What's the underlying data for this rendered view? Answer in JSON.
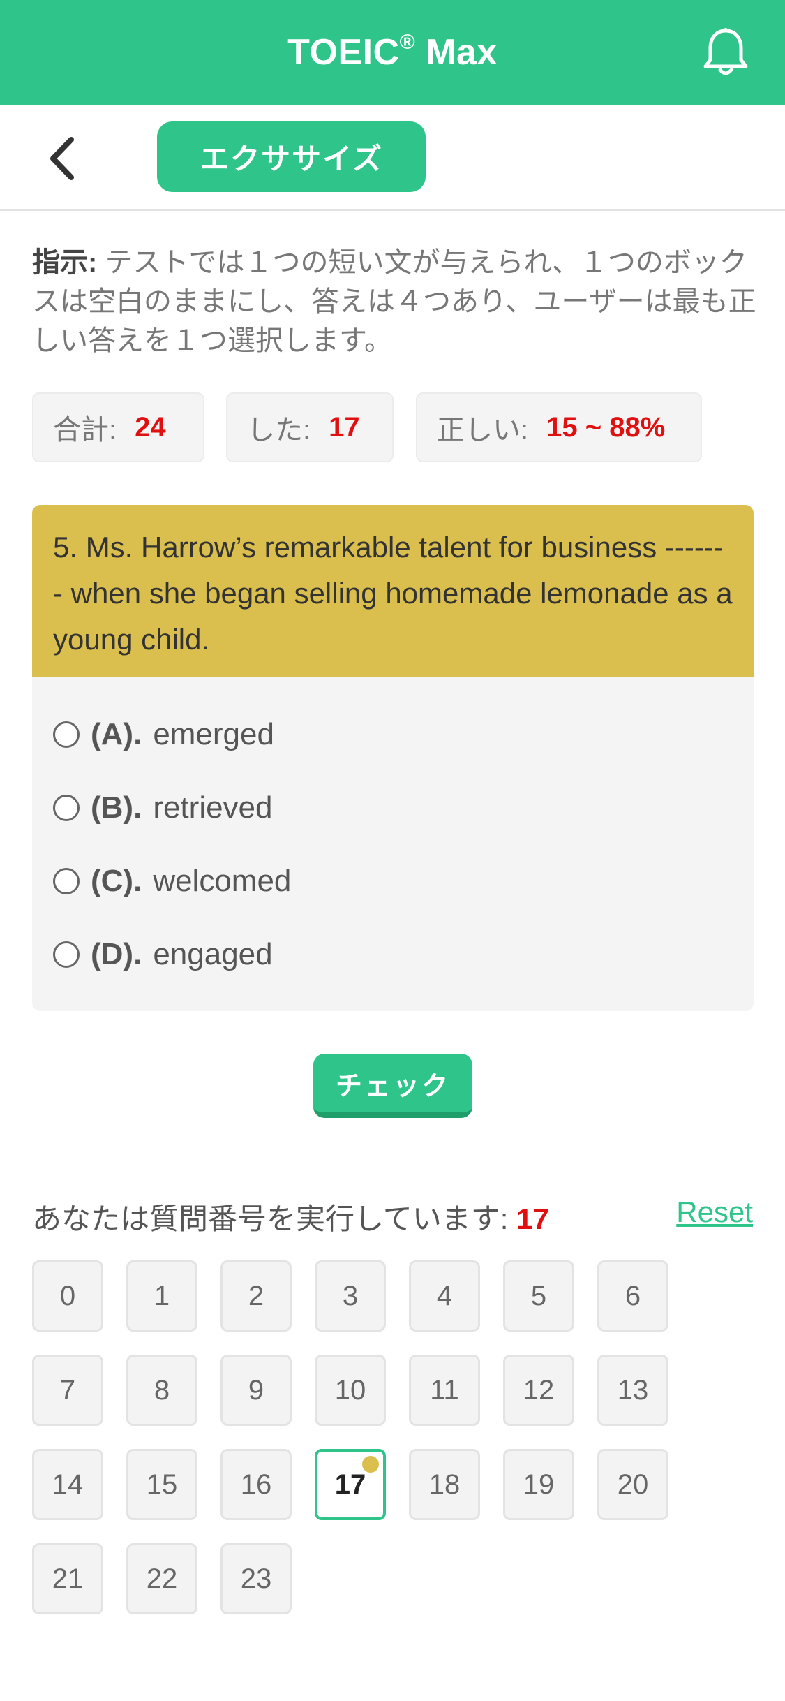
{
  "header": {
    "title": "TOEIC",
    "title_mark": "®",
    "title_suffix": " Max"
  },
  "subbar": {
    "tab_label": "エクササイズ"
  },
  "instructions": {
    "label": "指示:",
    "text": " テストでは１つの短い文が与えられ、１つのボックスは空白のままにし、答えは４つあり、ユーザーは最も正しい答えを１つ選択します。"
  },
  "stats": {
    "total_label": "合計:",
    "total_value": "24",
    "done_label": "した:",
    "done_value": "17",
    "correct_label": "正しい:",
    "correct_value": "15 ~ 88%"
  },
  "question": {
    "text": "5. Ms. Harrow’s remarkable talent for business ------- when she began selling homemade lemonade as a young child.",
    "options": [
      {
        "letter": "(A).",
        "text": "emerged"
      },
      {
        "letter": "(B).",
        "text": "retrieved"
      },
      {
        "letter": "(C).",
        "text": "welcomed"
      },
      {
        "letter": "(D).",
        "text": "engaged"
      }
    ]
  },
  "check_button": "チェック",
  "progress": {
    "running_label": "あなたは質問番号を実行しています: ",
    "current": "17",
    "reset_label": "Reset",
    "numbers": [
      "0",
      "1",
      "2",
      "3",
      "4",
      "5",
      "6",
      "7",
      "8",
      "9",
      "10",
      "11",
      "12",
      "13",
      "14",
      "15",
      "16",
      "17",
      "18",
      "19",
      "20",
      "21",
      "22",
      "23"
    ]
  },
  "colors": {
    "accent": "#2ec48a",
    "question_bg": "#dbbf4e",
    "highlight_red": "#e01010"
  }
}
